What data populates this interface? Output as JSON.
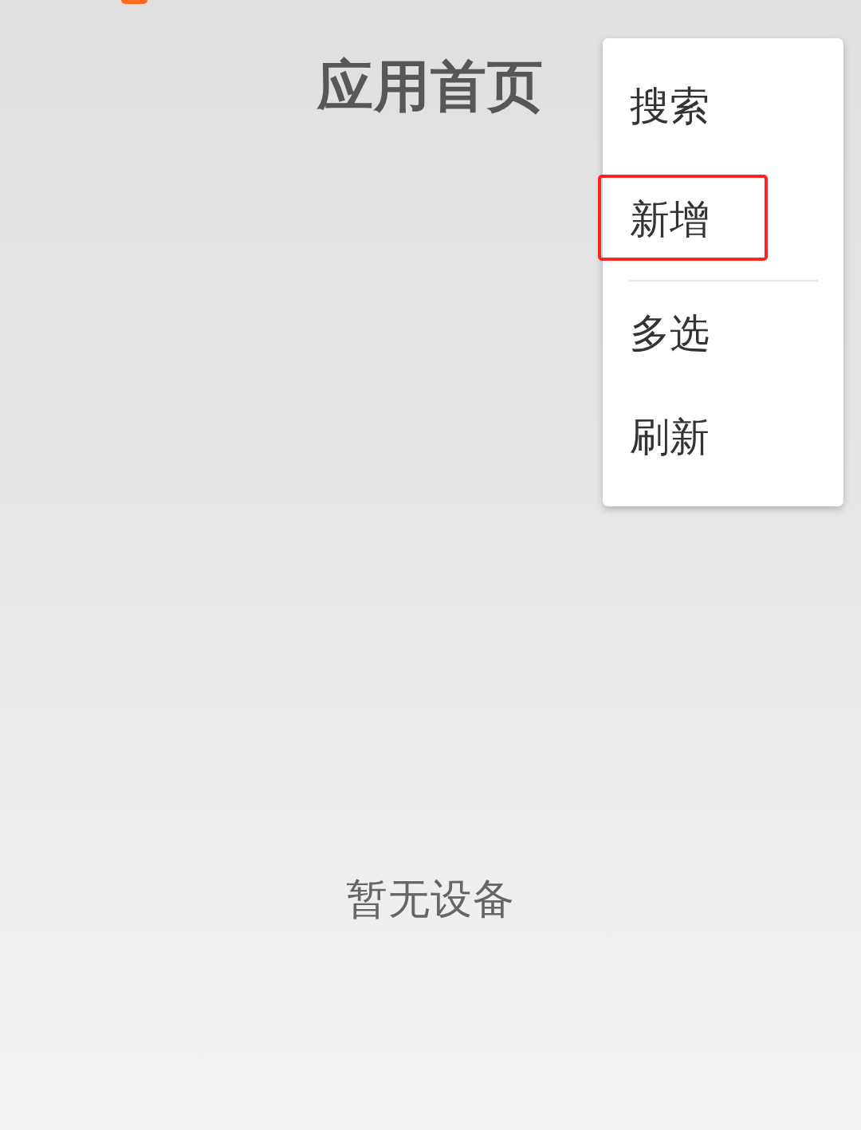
{
  "header": {
    "title": "应用首页"
  },
  "menu": {
    "groups": [
      {
        "items": [
          {
            "label": "搜索",
            "highlighted": false
          },
          {
            "label": "新增",
            "highlighted": true
          }
        ]
      },
      {
        "items": [
          {
            "label": "多选",
            "highlighted": false
          },
          {
            "label": "刷新",
            "highlighted": false
          }
        ]
      }
    ]
  },
  "empty_state": {
    "message": "暂无设备"
  }
}
